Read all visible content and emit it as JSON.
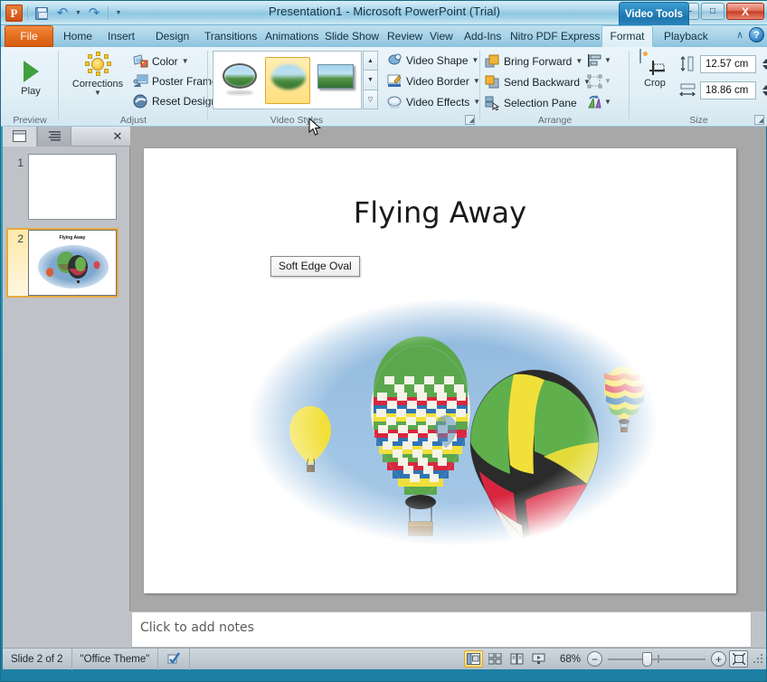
{
  "window": {
    "title": "Presentation1  -  Microsoft PowerPoint (Trial)",
    "app_logo": "powerpoint-logo",
    "minimize": "—",
    "maximize": "□",
    "close": "X"
  },
  "quick_access": {
    "save": "save-icon",
    "undo": "↶",
    "redo": "↷",
    "customize": "≡"
  },
  "contextual_tab": {
    "label": "Video Tools"
  },
  "tabs": [
    {
      "label": "File",
      "active": false
    },
    {
      "label": "Home",
      "active": false
    },
    {
      "label": "Insert",
      "active": false
    },
    {
      "label": "Design",
      "active": false
    },
    {
      "label": "Transitions",
      "active": false
    },
    {
      "label": "Animations",
      "active": false
    },
    {
      "label": "Slide Show",
      "active": false
    },
    {
      "label": "Review",
      "active": false
    },
    {
      "label": "View",
      "active": false
    },
    {
      "label": "Add-Ins",
      "active": false
    },
    {
      "label": "Nitro PDF Express",
      "active": false
    },
    {
      "label": "Format",
      "active": true
    },
    {
      "label": "Playback",
      "active": false
    }
  ],
  "help": {
    "collapse_ribbon": "∧",
    "help_icon": "?"
  },
  "ribbon": {
    "preview": {
      "group_label": "Preview",
      "play_label": "Play"
    },
    "adjust": {
      "group_label": "Adjust",
      "corrections_label": "Corrections",
      "items": [
        {
          "label": "Color",
          "icon": "color-icon",
          "has_dropdown": true
        },
        {
          "label": "Poster Frame",
          "icon": "poster-frame-icon",
          "has_dropdown": true
        },
        {
          "label": "Reset Design",
          "icon": "reset-design-icon",
          "has_dropdown": true
        }
      ]
    },
    "video_styles": {
      "group_label": "Video Styles",
      "thumbs": [
        {
          "name": "bevel-oval-style",
          "selected": false
        },
        {
          "name": "soft-edge-oval-style",
          "selected": true
        },
        {
          "name": "reflected-rounded-rectangle-style",
          "selected": false
        }
      ],
      "scroll_up": "▲",
      "scroll_down": "▼",
      "more": "▼"
    },
    "video_effects": {
      "items": [
        {
          "label": "Video Shape",
          "icon": "video-shape-icon",
          "has_dropdown": true
        },
        {
          "label": "Video Border",
          "icon": "video-border-icon",
          "has_dropdown": true
        },
        {
          "label": "Video Effects",
          "icon": "video-effects-icon",
          "has_dropdown": true
        }
      ]
    },
    "arrange": {
      "group_label": "Arrange",
      "items": [
        {
          "label": "Bring Forward",
          "icon": "bring-forward-icon",
          "has_dropdown": true
        },
        {
          "label": "Send Backward",
          "icon": "send-backward-icon",
          "has_dropdown": true
        },
        {
          "label": "Selection Pane",
          "icon": "selection-pane-icon",
          "has_dropdown": false
        }
      ],
      "icon_buttons": [
        {
          "name": "align-icon",
          "has_dropdown": true
        },
        {
          "name": "group-icon",
          "has_dropdown": true
        },
        {
          "name": "rotate-icon",
          "has_dropdown": true
        }
      ]
    },
    "size": {
      "group_label": "Size",
      "crop_label": "Crop",
      "height_value": "12.57 cm",
      "width_value": "18.86 cm",
      "height_icon": "shape-height-icon",
      "width_icon": "shape-width-icon",
      "dialog_launcher": "↘"
    }
  },
  "tooltip": {
    "text": "Soft Edge Oval"
  },
  "slides_pane": {
    "tab_slides": "slides-tab",
    "tab_outline": "outline-tab",
    "close": "✕",
    "slides": [
      {
        "number": "1",
        "selected": false,
        "has_content": false
      },
      {
        "number": "2",
        "selected": true,
        "has_content": true,
        "title": "Flying Away"
      }
    ]
  },
  "slide": {
    "title": "Flying Away",
    "video_object_name": "hot-air-balloons-video"
  },
  "notes": {
    "placeholder": "Click to add notes"
  },
  "scrollbars": {
    "up": "▲",
    "down": "▼",
    "prev_slide": "▲▲",
    "next_slide": "▼▼"
  },
  "status_bar": {
    "slide_counter": "Slide 2 of 2",
    "theme": "\"Office Theme\"",
    "spell_check": "spell-check-icon",
    "views": [
      {
        "name": "normal-view",
        "active": true
      },
      {
        "name": "slide-sorter-view",
        "active": false
      },
      {
        "name": "reading-view",
        "active": false
      },
      {
        "name": "slide-show-view",
        "active": false
      }
    ],
    "zoom_percent": "68%",
    "zoom_out": "−",
    "zoom_in": "+",
    "fit_to_window": "fit-slide-icon"
  },
  "colors": {
    "accent_blue": "#2e95b8",
    "file_tab_orange": "#e5701f",
    "selection_gold": "#e8a93c",
    "sky_blue": "#9cc1e2"
  }
}
